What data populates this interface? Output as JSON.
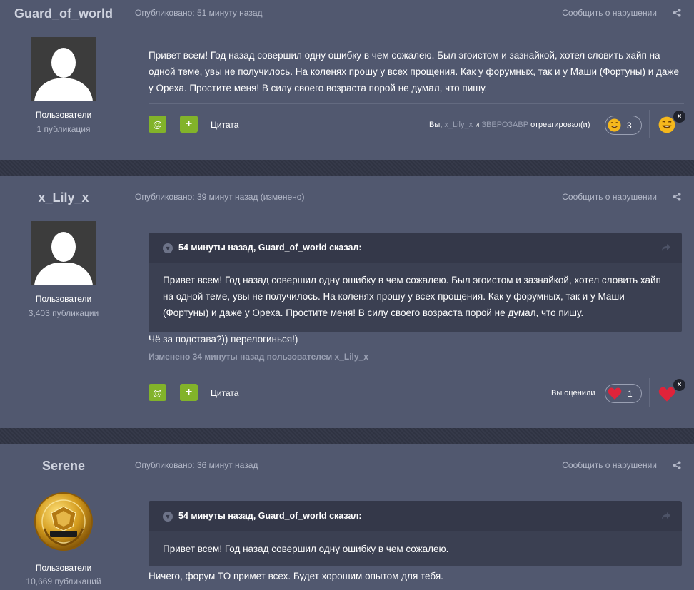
{
  "posts": [
    {
      "author": "Guard_of_world",
      "group": "Пользователи",
      "post_count": "1 публикация",
      "meta": "Опубликовано: 51 минуту назад",
      "report": "Сообщить о нарушении",
      "text": "Привет всем! Год назад совершил одну ошибку в чем сожалею. Был эгоистом и заз­найкой, хотел словить хайп на одной теме, увы не получилось. На коленях прошу у всех прощения. Как у форумных, так и у Маши (Фортуны) и даже у Ореха. Простите меня! В силу своего возраста порой не думал, что пишу.",
      "mention_btn": "@",
      "plus_btn": "+",
      "quote_label": "Цитата",
      "reactions": {
        "prefix": "Вы,",
        "user1": "x_Lily_x",
        "and": "и",
        "user2": "ЗВЕРОЗАВР",
        "suffix": "отреагировал(и)",
        "count": "3",
        "icon": "laughing-face-icon"
      },
      "close": "×"
    },
    {
      "author": "x_Lily_x",
      "group": "Пользователи",
      "post_count": "3,403 публикации",
      "meta": "Опубликовано: 39 минут назад (изменено)",
      "report": "Сообщить о нарушении",
      "quote_title": "54 минуты назад, Guard_of_world сказал:",
      "quote_text": "Привет всем! Год назад совершил одну ошибку в чем сожалею. Был эгоистом и заз­найкой, хотел словить хайп на одной теме, увы не получилось. На коленях прошу у всех прощения. Как у форумных, так и у Маши (Фортуны) и даже у Ореха. Простите меня! В силу своего возраста порой не думал, что пишу.",
      "text": "Чё за подстава?)) перелогинься!)",
      "edited": "Изменено 34 минуты назад пользователем x_Lily_x",
      "mention_btn": "@",
      "plus_btn": "+",
      "quote_label": "Цитата",
      "reactions": {
        "label": "Вы оценили",
        "count": "1",
        "icon": "heart-icon"
      },
      "close": "×"
    },
    {
      "author": "Serene",
      "group": "Пользователи",
      "post_count": "10,669 публикаций",
      "meta": "Опубликовано: 36 минут назад",
      "report": "Сообщить о нарушении",
      "avatar_medal_text": "ЗА ЗАСЛУГИ",
      "quote_title": "54 минуты назад, Guard_of_world сказал:",
      "quote_text": "Привет всем! Год назад совершил одну ошибку в чем сожалею.",
      "text": "Ничего, форум ТО примет всех. Будет хорошим опытом для тебя."
    }
  ]
}
